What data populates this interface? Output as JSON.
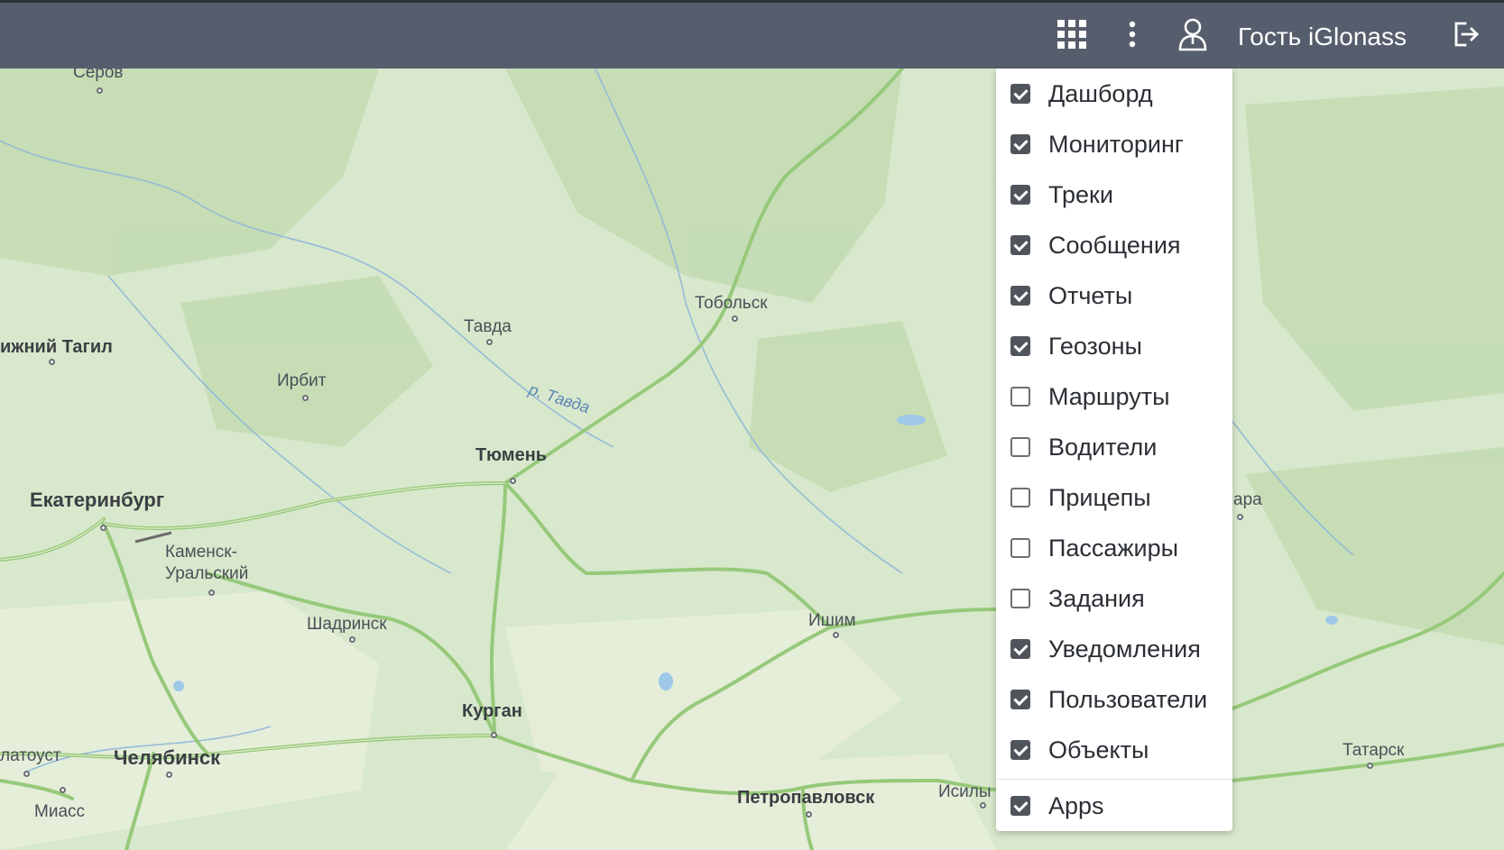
{
  "header": {
    "user_name": "Гость iGlonass",
    "icons": {
      "apps": "apps-grid-icon",
      "more": "more-vertical-icon",
      "user": "user-icon",
      "logout": "logout-icon"
    },
    "color": "#565e6d"
  },
  "map": {
    "labels": {
      "serov": "Серов",
      "nizhny_tagil": "ижний Тагил",
      "irbit": "Ирбит",
      "tavda": "Тавда",
      "tavda_river": "р. Тавда",
      "tobolsk": "Тобольск",
      "tyumen": "Тюмень",
      "yekaterinburg": "Екатеринбург",
      "kamensk": "Каменск-\nУральский",
      "shadrinsk": "Шадринск",
      "ishim": "Ишим",
      "kurgan": "Курган",
      "zlatoust": "латоуст",
      "chelyabinsk": "Челябинск",
      "miass": "Миасс",
      "petropavlovsk": "Петропавловск",
      "isilkul": "Исилы",
      "tara": "ара",
      "tatarsk": "Татарск"
    }
  },
  "menu": {
    "items": [
      {
        "label": "Дашборд",
        "checked": true
      },
      {
        "label": "Мониторинг",
        "checked": true
      },
      {
        "label": "Треки",
        "checked": true
      },
      {
        "label": "Сообщения",
        "checked": true
      },
      {
        "label": "Отчеты",
        "checked": true
      },
      {
        "label": "Геозоны",
        "checked": true
      },
      {
        "label": "Маршруты",
        "checked": false
      },
      {
        "label": "Водители",
        "checked": false
      },
      {
        "label": "Прицепы",
        "checked": false
      },
      {
        "label": "Пассажиры",
        "checked": false
      },
      {
        "label": "Задания",
        "checked": false
      },
      {
        "label": "Уведомления",
        "checked": true
      },
      {
        "label": "Пользователи",
        "checked": true
      },
      {
        "label": "Объекты",
        "checked": true
      },
      {
        "label": "Apps",
        "checked": true
      }
    ]
  }
}
